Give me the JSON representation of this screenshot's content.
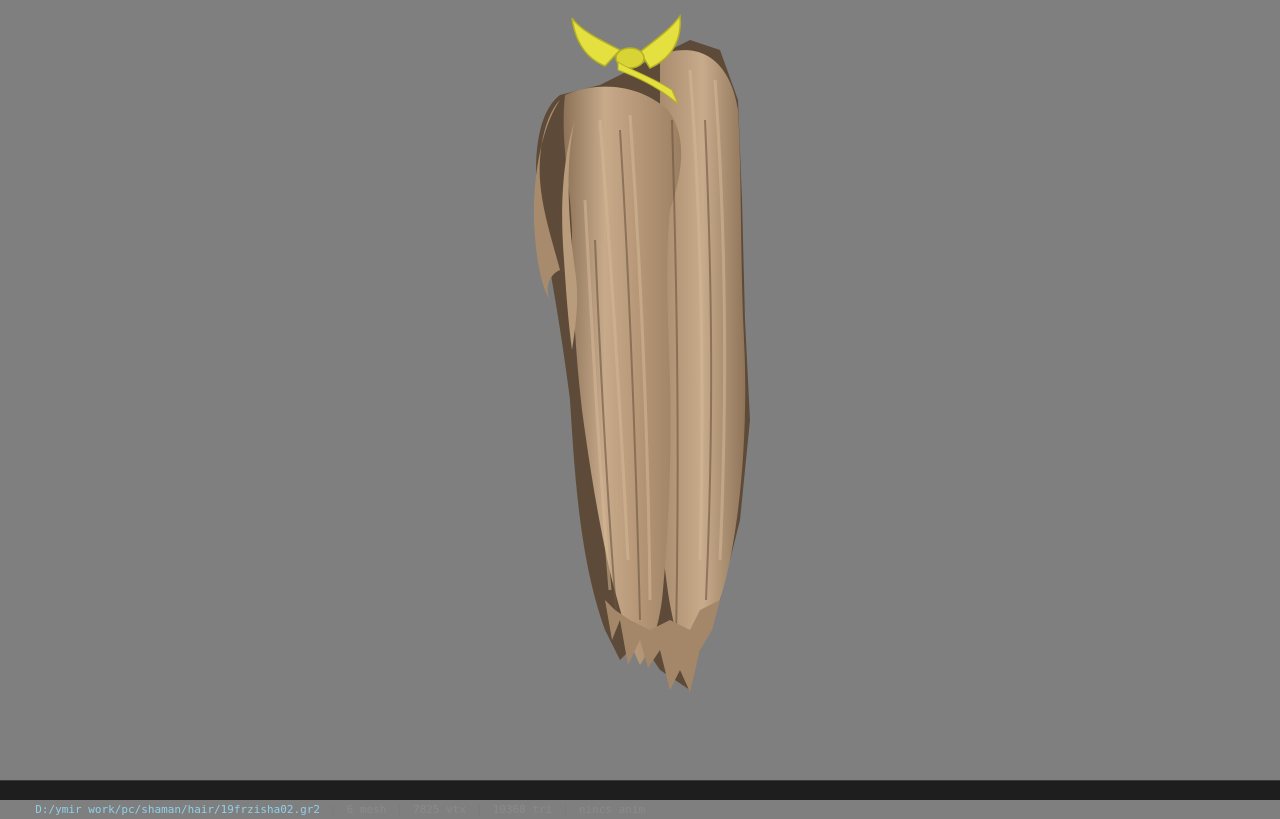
{
  "viewport": {
    "background": "#7f7f7f",
    "model_name": "hair-model",
    "colors": {
      "hair_light": "#c5a888",
      "hair_mid": "#a88b6c",
      "hair_dark": "#5e4a38",
      "ribbon": "#e4e040",
      "ribbon_shade": "#b5b020"
    }
  },
  "status": {
    "path": "D:/ymir work/pc/shaman/hair/19frzisha02.gr2",
    "separator": "|",
    "mesh": "6 mesh",
    "vtx": "7825 vtx",
    "tri": "10368 tri",
    "anim": "nincs anim"
  }
}
